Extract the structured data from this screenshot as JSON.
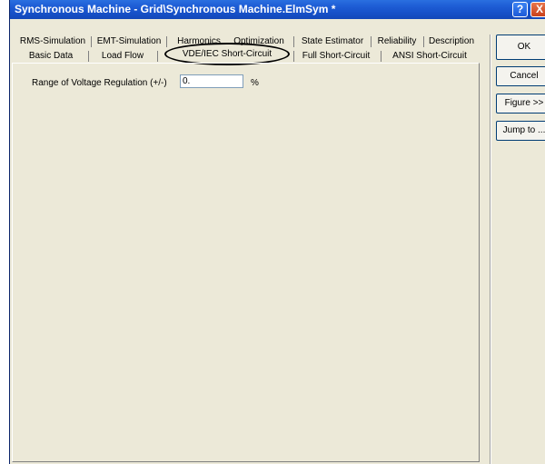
{
  "window": {
    "title": "Synchronous Machine - Grid\\Synchronous Machine.ElmSym *",
    "help_label": "?",
    "close_label": "X"
  },
  "tabs": {
    "row1": [
      "RMS-Simulation",
      "EMT-Simulation",
      "Harmonics",
      "Optimization",
      "State Estimator",
      "Reliability",
      "Description"
    ],
    "row2": [
      "Basic Data",
      "Load Flow",
      "VDE/IEC Short-Circuit",
      "Full Short-Circuit",
      "ANSI Short-Circuit"
    ],
    "active": "VDE/IEC Short-Circuit"
  },
  "form": {
    "voltage_regulation_label": "Range of Voltage Regulation (+/-)",
    "voltage_regulation_value": "0.",
    "voltage_regulation_unit": "%"
  },
  "buttons": {
    "ok": "OK",
    "cancel": "Cancel",
    "figure": "Figure >>",
    "jump": "Jump to ..."
  }
}
